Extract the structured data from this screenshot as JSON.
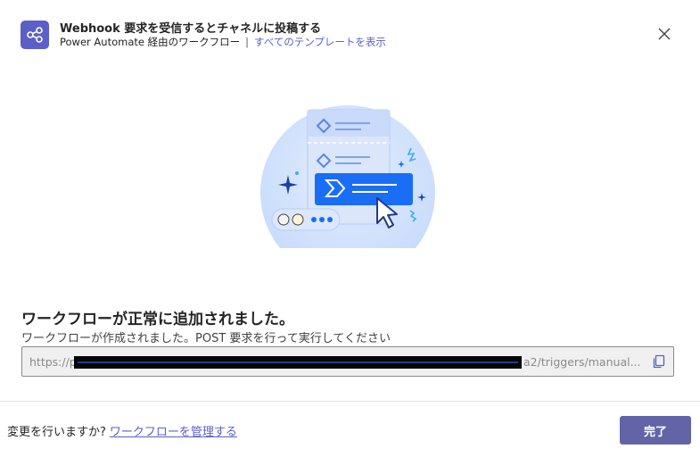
{
  "header": {
    "icon": "flow-connector-icon",
    "title": "Webhook 要求を受信するとチャネルに投稿する",
    "subtitle": "Power Automate 経由のワークフロー",
    "separator": "|",
    "templates_link": "すべてのテンプレートを表示"
  },
  "content": {
    "success_title": "ワークフローが正常に追加されました。",
    "success_desc": "ワークフローが作成されました。POST 要求を行って実行してください",
    "url_start": "https://p",
    "url_end": "a2/triggers/manual..."
  },
  "footer": {
    "question": "変更を行いますか?",
    "manage_link": "ワークフローを管理する",
    "done_button": "完了"
  },
  "colors": {
    "accent": "#5b5fc7",
    "button": "#6264a7",
    "illustration_blue": "#1a6ef5"
  }
}
